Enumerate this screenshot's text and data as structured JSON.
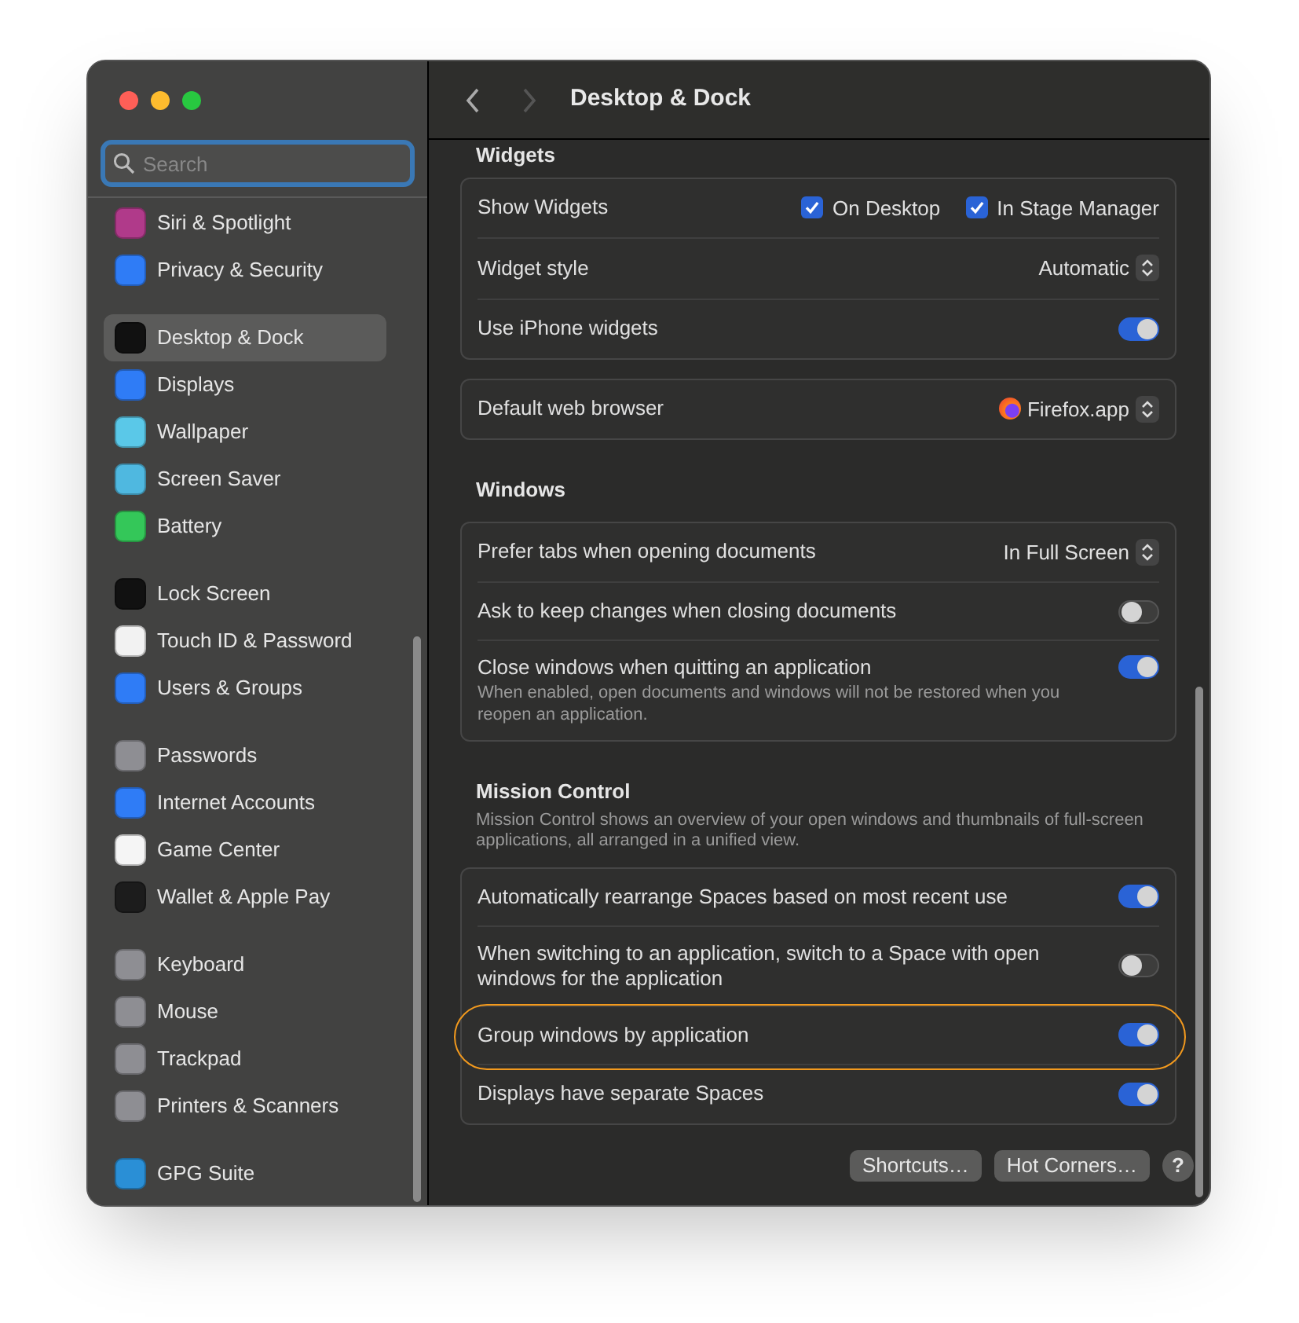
{
  "window": {
    "title": "Desktop & Dock"
  },
  "sidebar": {
    "search": {
      "placeholder": "Search"
    },
    "groups": [
      {
        "items": [
          {
            "label": "Siri & Spotlight",
            "color": "#b03a8a",
            "selected": false
          },
          {
            "label": "Privacy & Security",
            "color": "#2f7cf6",
            "selected": false
          }
        ]
      },
      {
        "items": [
          {
            "label": "Desktop & Dock",
            "color": "#111111",
            "selected": true
          },
          {
            "label": "Displays",
            "color": "#2f7cf6",
            "selected": false
          },
          {
            "label": "Wallpaper",
            "color": "#5ac8e8",
            "selected": false
          },
          {
            "label": "Screen Saver",
            "color": "#4fb8e0",
            "selected": false
          },
          {
            "label": "Battery",
            "color": "#34c759",
            "selected": false
          }
        ]
      },
      {
        "items": [
          {
            "label": "Lock Screen",
            "color": "#111111",
            "selected": false
          },
          {
            "label": "Touch ID & Password",
            "color": "#f2f2f2",
            "selected": false
          },
          {
            "label": "Users & Groups",
            "color": "#2f7cf6",
            "selected": false
          }
        ]
      },
      {
        "items": [
          {
            "label": "Passwords",
            "color": "#8e8e93",
            "selected": false
          },
          {
            "label": "Internet Accounts",
            "color": "#2f7cf6",
            "selected": false
          },
          {
            "label": "Game Center",
            "color": "#f5f5f5",
            "selected": false
          },
          {
            "label": "Wallet & Apple Pay",
            "color": "#1c1c1c",
            "selected": false
          }
        ]
      },
      {
        "items": [
          {
            "label": "Keyboard",
            "color": "#8e8e93",
            "selected": false
          },
          {
            "label": "Mouse",
            "color": "#8e8e93",
            "selected": false
          },
          {
            "label": "Trackpad",
            "color": "#8e8e93",
            "selected": false
          },
          {
            "label": "Printers & Scanners",
            "color": "#8e8e93",
            "selected": false
          }
        ]
      },
      {
        "items": [
          {
            "label": "GPG Suite",
            "color": "#2a8fd6",
            "selected": false
          }
        ]
      }
    ]
  },
  "sections": [
    {
      "title": "Widgets",
      "groups": [
        [
          {
            "kind": "checks",
            "label": "Show Widgets",
            "checks": [
              {
                "label": "On Desktop",
                "checked": true
              },
              {
                "label": "In Stage Manager",
                "checked": true
              }
            ]
          },
          {
            "kind": "popup",
            "label": "Widget style",
            "value": "Automatic"
          },
          {
            "kind": "toggle",
            "label": "Use iPhone widgets",
            "on": true
          }
        ],
        [
          {
            "kind": "popup",
            "label": "Default web browser",
            "value": "Firefox.app",
            "app_icon": true
          }
        ]
      ]
    },
    {
      "title": "Windows",
      "groups": [
        [
          {
            "kind": "popup",
            "label": "Prefer tabs when opening documents",
            "value": "In Full Screen"
          },
          {
            "kind": "toggle",
            "label": "Ask to keep changes when closing documents",
            "on": false
          },
          {
            "kind": "toggle",
            "label": "Close windows when quitting an application",
            "note": "When enabled, open documents and windows will not be restored when you reopen an application.",
            "on": true
          }
        ]
      ]
    },
    {
      "title": "Mission Control",
      "description": "Mission Control shows an overview of your open windows and thumbnails of full-screen applications, all arranged in a unified view.",
      "groups": [
        [
          {
            "kind": "toggle",
            "label": "Automatically rearrange Spaces based on most recent use",
            "on": true
          },
          {
            "kind": "toggle",
            "label": "When switching to an application, switch to a Space with open windows for the application",
            "on": false
          },
          {
            "kind": "toggle",
            "label": "Group windows by application",
            "on": true,
            "highlighted": true
          },
          {
            "kind": "toggle",
            "label": "Displays have separate Spaces",
            "on": true
          }
        ]
      ]
    }
  ],
  "buttons": [
    "Shortcuts…",
    "Hot Corners…"
  ],
  "help": "?"
}
